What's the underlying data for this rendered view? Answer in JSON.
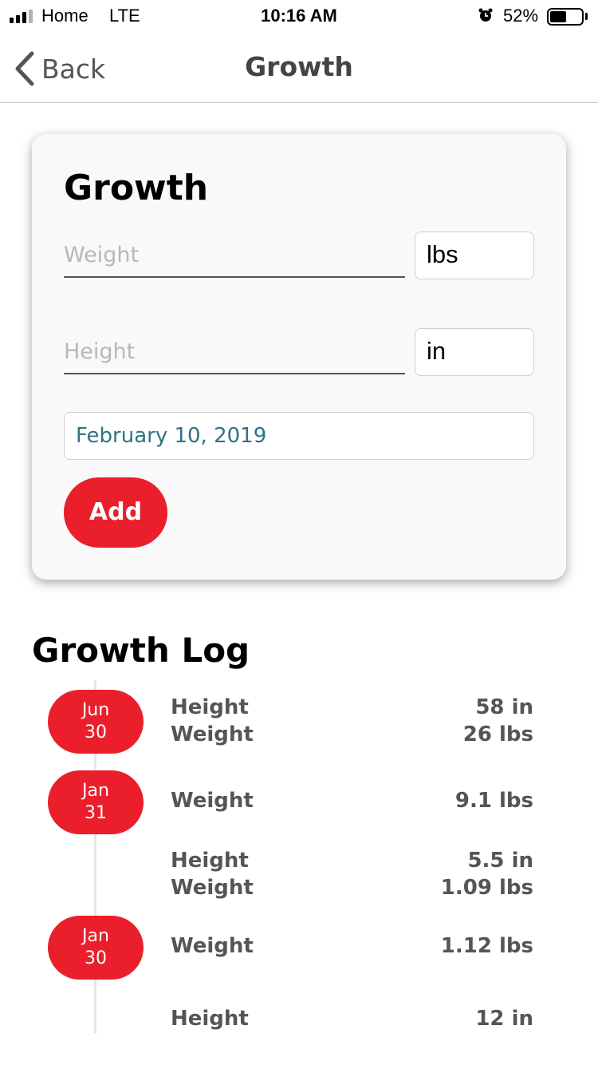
{
  "status_bar": {
    "carrier": "Home",
    "network": "LTE",
    "time": "10:16 AM",
    "battery_percent_label": "52%",
    "battery_level": 0.52,
    "signal_bars": 3,
    "icons": [
      "signal-icon",
      "alarm-icon",
      "battery-icon"
    ]
  },
  "nav": {
    "back_label": "Back",
    "title": "Growth"
  },
  "form": {
    "title": "Growth",
    "weight_placeholder": "Weight",
    "weight_value": "",
    "weight_unit": "lbs",
    "height_placeholder": "Height",
    "height_value": "",
    "height_unit": "in",
    "date": "February 10, 2019",
    "add_label": "Add"
  },
  "log": {
    "title": "Growth Log",
    "dates": [
      {
        "month": "Jun",
        "day": "30"
      },
      {
        "month": "Jan",
        "day": "31"
      },
      {
        "month": "Jan",
        "day": "30"
      }
    ],
    "entries": [
      {
        "label": "Height",
        "value": "58 in"
      },
      {
        "label": "Weight",
        "value": "26 lbs"
      },
      {
        "label": "Weight",
        "value": "9.1 lbs"
      },
      {
        "label": "Height",
        "value": "5.5 in"
      },
      {
        "label": "Weight",
        "value": "1.09 lbs"
      },
      {
        "label": "Weight",
        "value": "1.12 lbs"
      },
      {
        "label": "Height",
        "value": "12 in"
      }
    ]
  },
  "colors": {
    "accent": "#ea1f2b",
    "date_text": "#2f7384",
    "log_text": "#555555"
  }
}
